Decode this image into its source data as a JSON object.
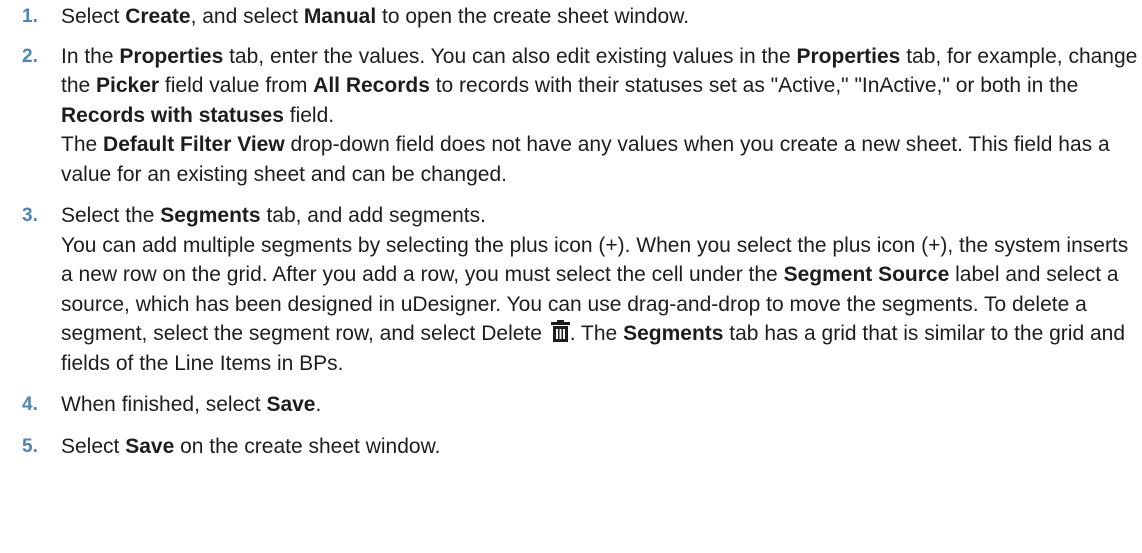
{
  "steps": [
    {
      "num": "1.",
      "t1": "Select ",
      "b1": "Create",
      "t2": ", and select ",
      "b2": "Manual",
      "t3": " to open the create sheet window."
    },
    {
      "num": "2.",
      "p1": {
        "t1": "In the ",
        "b1": "Properties",
        "t2": " tab, enter the values. You can also edit existing values in the ",
        "b2": "Properties",
        "t3": " tab, for example, change the ",
        "b3": "Picker",
        "t4": " field value from ",
        "b4": "All Records",
        "t5": " to records with their statuses set as \"Active,\" \"InActive,\" or both in the ",
        "b5": "Records with statuses",
        "t6": " field."
      },
      "p2": {
        "t1": "The ",
        "b1": "Default Filter View",
        "t2": " drop-down field does not have any values when you create a new sheet. This field has a value for an existing sheet and can be changed."
      }
    },
    {
      "num": "3.",
      "p1": {
        "t1": "Select the ",
        "b1": "Segments",
        "t2": " tab, and add segments."
      },
      "p2": {
        "t1": "You can add multiple segments by selecting the plus icon (+). When you select the plus icon (+), the system inserts a new row on the grid. After you add a row, you must select the cell under the ",
        "b1": "Segment Source",
        "t2": " label and select a source, which has been designed in uDesigner. You can use drag-and-drop to move the segments. To delete a segment, select the segment row, and select Delete ",
        "t3": ". The ",
        "b2": "Segments",
        "t4": " tab has a grid that is similar to the grid and fields of the Line Items in BPs."
      },
      "icon": "trash-icon"
    },
    {
      "num": "4.",
      "t1": "When finished, select ",
      "b1": "Save",
      "t2": "."
    },
    {
      "num": "5.",
      "t1": "Select ",
      "b1": "Save",
      "t2": " on the create sheet window."
    }
  ],
  "colors": {
    "number": "#4d85b5",
    "text": "#1d1d1d"
  }
}
